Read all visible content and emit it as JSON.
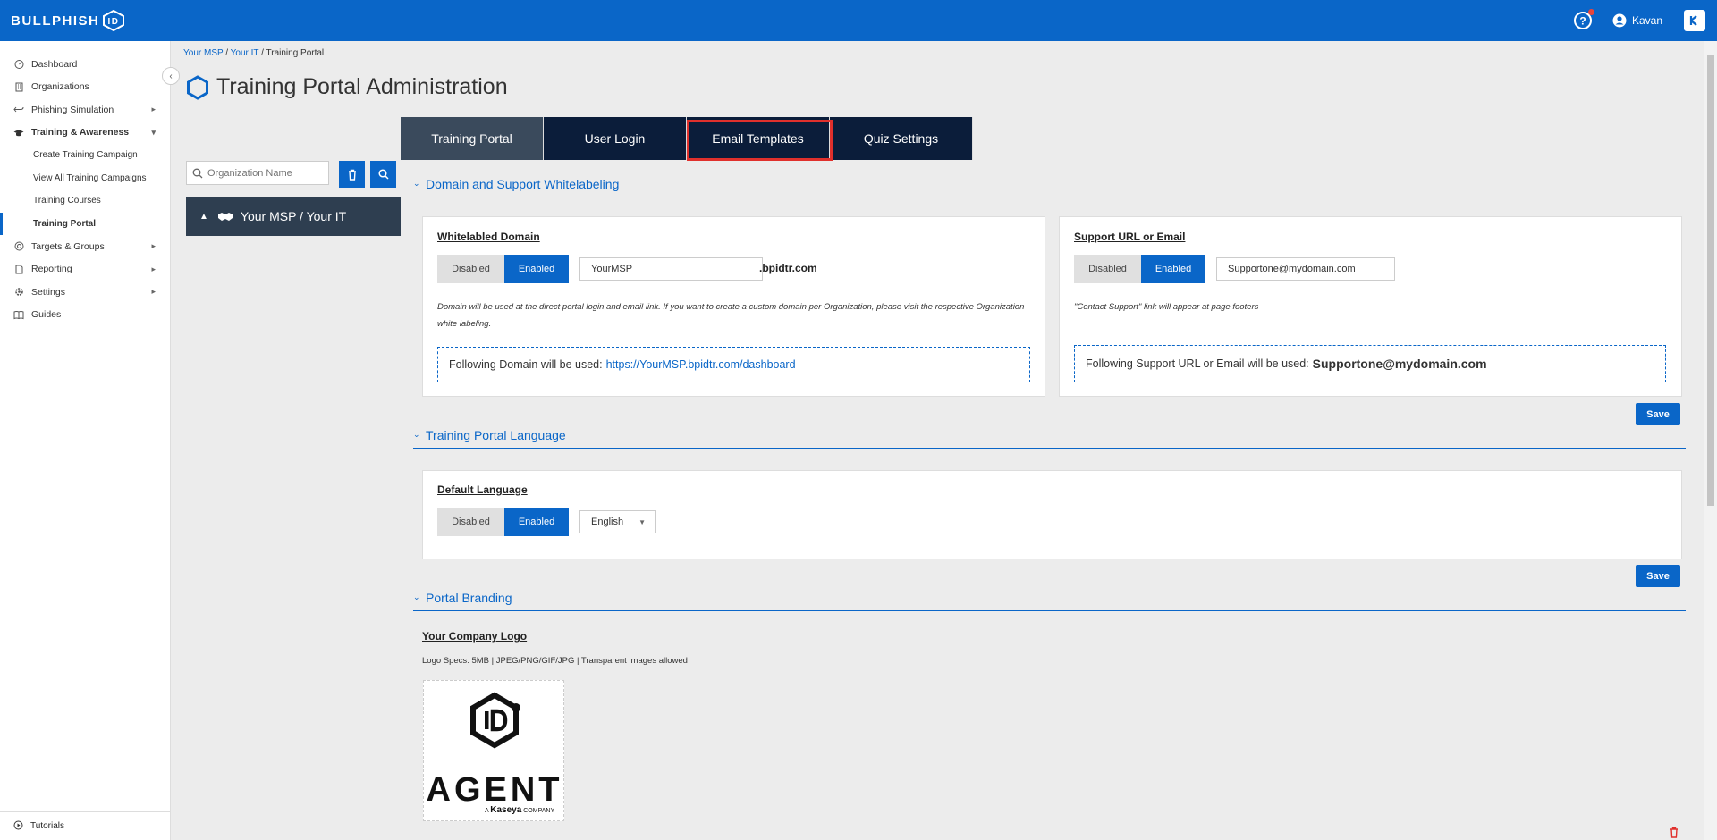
{
  "app": {
    "brand": "BULLPHISH",
    "brand_mark": "ID",
    "user_name": "Kavan"
  },
  "sidebar": {
    "items": [
      {
        "label": "Dashboard",
        "icon": "dashboard-icon"
      },
      {
        "label": "Organizations",
        "icon": "building-icon"
      },
      {
        "label": "Phishing Simulation",
        "icon": "hook-icon",
        "has_children": true
      },
      {
        "label": "Training & Awareness",
        "icon": "graduation-cap-icon",
        "expanded": true
      },
      {
        "label": "Targets & Groups",
        "icon": "target-icon",
        "has_children": true
      },
      {
        "label": "Reporting",
        "icon": "report-icon",
        "has_children": true
      },
      {
        "label": "Settings",
        "icon": "gear-icon",
        "has_children": true
      },
      {
        "label": "Guides",
        "icon": "book-icon"
      }
    ],
    "sub_items": [
      "Create Training Campaign",
      "View All Training Campaigns",
      "Training Courses",
      "Training Portal"
    ],
    "active_sub_item": "Training Portal",
    "footer_label": "Tutorials"
  },
  "breadcrumb": {
    "part1": "Your MSP",
    "sep": " / ",
    "part2": "Your IT",
    "current": "Training Portal"
  },
  "page": {
    "title": "Training Portal Administration"
  },
  "org_panel": {
    "search_placeholder": "Organization Name",
    "tree_label": "Your MSP / Your IT"
  },
  "tabs": [
    "Training Portal",
    "User Login",
    "Email Templates",
    "Quiz Settings"
  ],
  "active_tab": "Training Portal",
  "highlighted_tab": "Email Templates",
  "sections": {
    "domain": {
      "title": "Domain and Support Whitelabeling",
      "whitelabel": {
        "title": "Whitelabled Domain",
        "disabled_label": "Disabled",
        "enabled_label": "Enabled",
        "state": "Enabled",
        "domain_value": "YourMSP",
        "domain_suffix": ".bpidtr.com",
        "note": "Domain will be used at the direct portal login and email link. If you want to create a custom domain per Organization, please visit the respective Organization white labeling.",
        "following_label": "Following Domain will be used:",
        "following_value": "https://YourMSP.bpidtr.com/dashboard"
      },
      "support": {
        "title": "Support URL or Email",
        "disabled_label": "Disabled",
        "enabled_label": "Enabled",
        "state": "Enabled",
        "value": "Supportone@mydomain.com",
        "note": "\"Contact Support\" link will appear at page footers",
        "following_label": "Following Support URL or Email will be used:",
        "following_value": "Supportone@mydomain.com"
      },
      "save_label": "Save"
    },
    "language": {
      "title": "Training Portal Language",
      "card_title": "Default Language",
      "disabled_label": "Disabled",
      "enabled_label": "Enabled",
      "state": "Enabled",
      "selected": "English",
      "save_label": "Save"
    },
    "branding": {
      "title": "Portal Branding",
      "logo_title": "Your Company Logo",
      "logo_specs": "Logo Specs: 5MB | JPEG/PNG/GIF/JPG | Transparent images allowed",
      "logo_word": "AGENT",
      "logo_sub_prefix": "A",
      "logo_sub_brand": "Kaseya",
      "logo_sub_suffix": "COMPANY"
    }
  },
  "colors": {
    "primary": "#0a66c8",
    "nav_dark": "#0b1d3a",
    "tab_active": "#3a4a5c",
    "highlight_border": "#e0302c"
  }
}
